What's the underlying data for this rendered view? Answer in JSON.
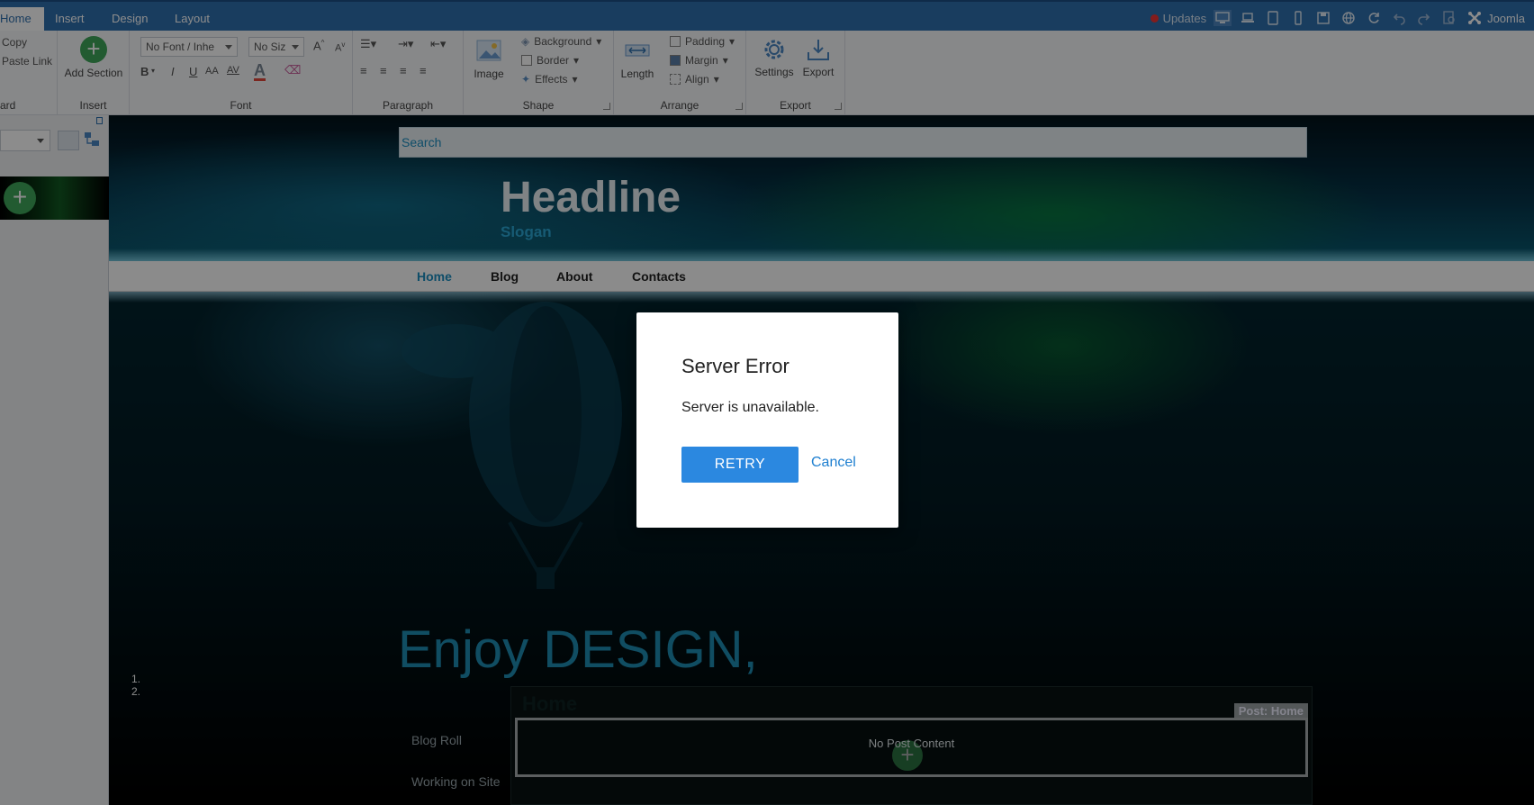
{
  "tabs": [
    {
      "label": "Home"
    },
    {
      "label": "Insert"
    },
    {
      "label": "Design"
    },
    {
      "label": "Layout"
    }
  ],
  "topright": {
    "updates_label": "Updates",
    "cms_label": "Joomla"
  },
  "ribbon": {
    "clipboard": {
      "copy": "Copy",
      "paste_link": "Paste Link",
      "group_label": "ard"
    },
    "insert": {
      "add_section": "Add Section",
      "group_label": "Insert"
    },
    "font": {
      "family": "No Font / Inhe",
      "size": "No Siz",
      "group_label": "Font"
    },
    "paragraph": {
      "group_label": "Paragraph"
    },
    "shape": {
      "image": "Image",
      "background": "Background",
      "border": "Border",
      "effects": "Effects",
      "group_label": "Shape"
    },
    "arrange": {
      "length": "Length",
      "padding": "Padding",
      "margin": "Margin",
      "align": "Align",
      "group_label": "Arrange"
    },
    "export": {
      "settings": "Settings",
      "export": "Export",
      "group_label": "Export"
    }
  },
  "leftpanel": {
    "list_items": [
      "1.",
      "2."
    ]
  },
  "page": {
    "search_placeholder": "Search",
    "headline": "Headline",
    "slogan": "Slogan",
    "nav": [
      "Home",
      "Blog",
      "About",
      "Contacts"
    ],
    "enjoy": "Enjoy DESIGN,",
    "sidebar": [
      "Blog Roll",
      "Working on Site"
    ],
    "post_title": "Home",
    "post_label": "Post: Home",
    "post_content": "No Post Content"
  },
  "dialog": {
    "title": "Server Error",
    "message": "Server is unavailable.",
    "retry": "RETRY",
    "cancel": "Cancel"
  },
  "colors": {
    "accent": "#2f6fad",
    "dialog_button": "#2b88e0",
    "link": "#1e7fd0",
    "headline_blue": "#1e8cb3"
  }
}
